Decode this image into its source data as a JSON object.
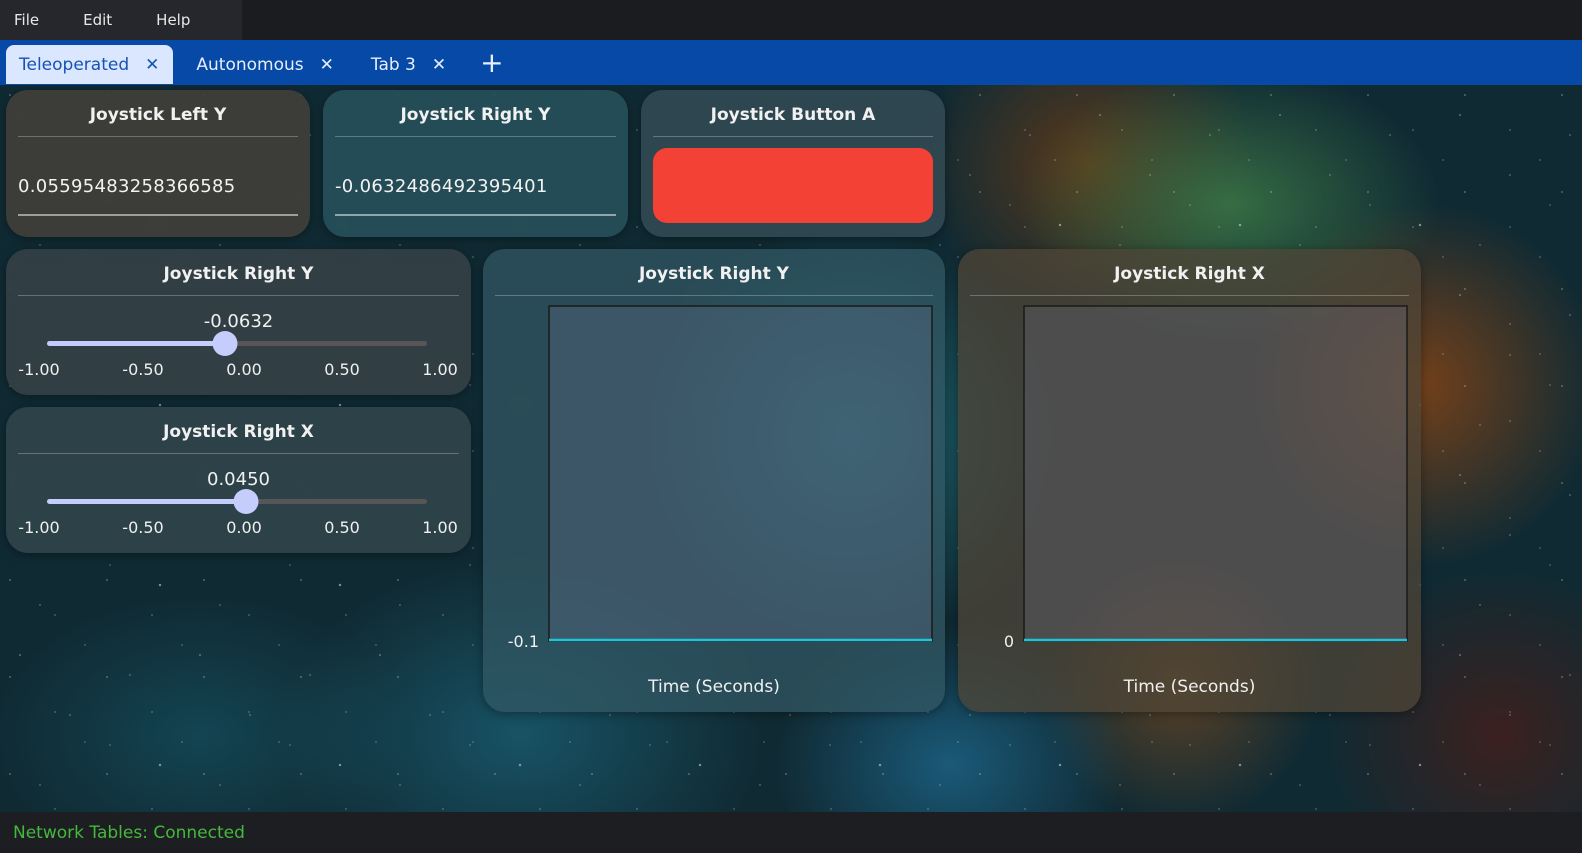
{
  "menu": {
    "items": [
      {
        "label": "File"
      },
      {
        "label": "Edit"
      },
      {
        "label": "Help"
      }
    ]
  },
  "tabs": [
    {
      "label": "Teleoperated",
      "active": true,
      "close": "✕"
    },
    {
      "label": "Autonomous",
      "active": false,
      "close": "✕"
    },
    {
      "label": "Tab 3",
      "active": false,
      "close": "✕"
    }
  ],
  "tab_add": "+",
  "widgets": {
    "left_y_text": {
      "title": "Joystick Left Y",
      "value": "0.05595483258366585"
    },
    "right_y_text": {
      "title": "Joystick Right Y",
      "value": "-0.0632486492395401"
    },
    "button_a": {
      "title": "Joystick Button A",
      "color": "#f34235",
      "state": false
    },
    "right_y_slider": {
      "title": "Joystick Right Y",
      "value_label": "-0.0632",
      "value": -0.0632,
      "min": -1.0,
      "max": 1.0,
      "ticks": [
        "-1.00",
        "-0.50",
        "0.00",
        "0.50",
        "1.00"
      ]
    },
    "right_x_slider": {
      "title": "Joystick Right X",
      "value_label": "0.0450",
      "value": 0.045,
      "min": -1.0,
      "max": 1.0,
      "ticks": [
        "-1.00",
        "-0.50",
        "0.00",
        "0.50",
        "1.00"
      ]
    }
  },
  "chart_data": [
    {
      "type": "line",
      "title": "Joystick Right Y",
      "xlabel": "Time (Seconds)",
      "ylabel": "",
      "y_tick_labels": [
        "-0.1"
      ],
      "series": [
        {
          "values": [
            -0.0632,
            -0.0632
          ],
          "color": "#1fc4d6"
        }
      ],
      "grid": false
    },
    {
      "type": "line",
      "title": "Joystick Right X",
      "xlabel": "Time (Seconds)",
      "ylabel": "",
      "y_tick_labels": [
        "0"
      ],
      "series": [
        {
          "values": [
            0.045,
            0.045
          ],
          "color": "#1fc4d6"
        }
      ],
      "grid": false
    }
  ],
  "status": {
    "text": "Network Tables: Connected",
    "color": "#45b83d"
  }
}
